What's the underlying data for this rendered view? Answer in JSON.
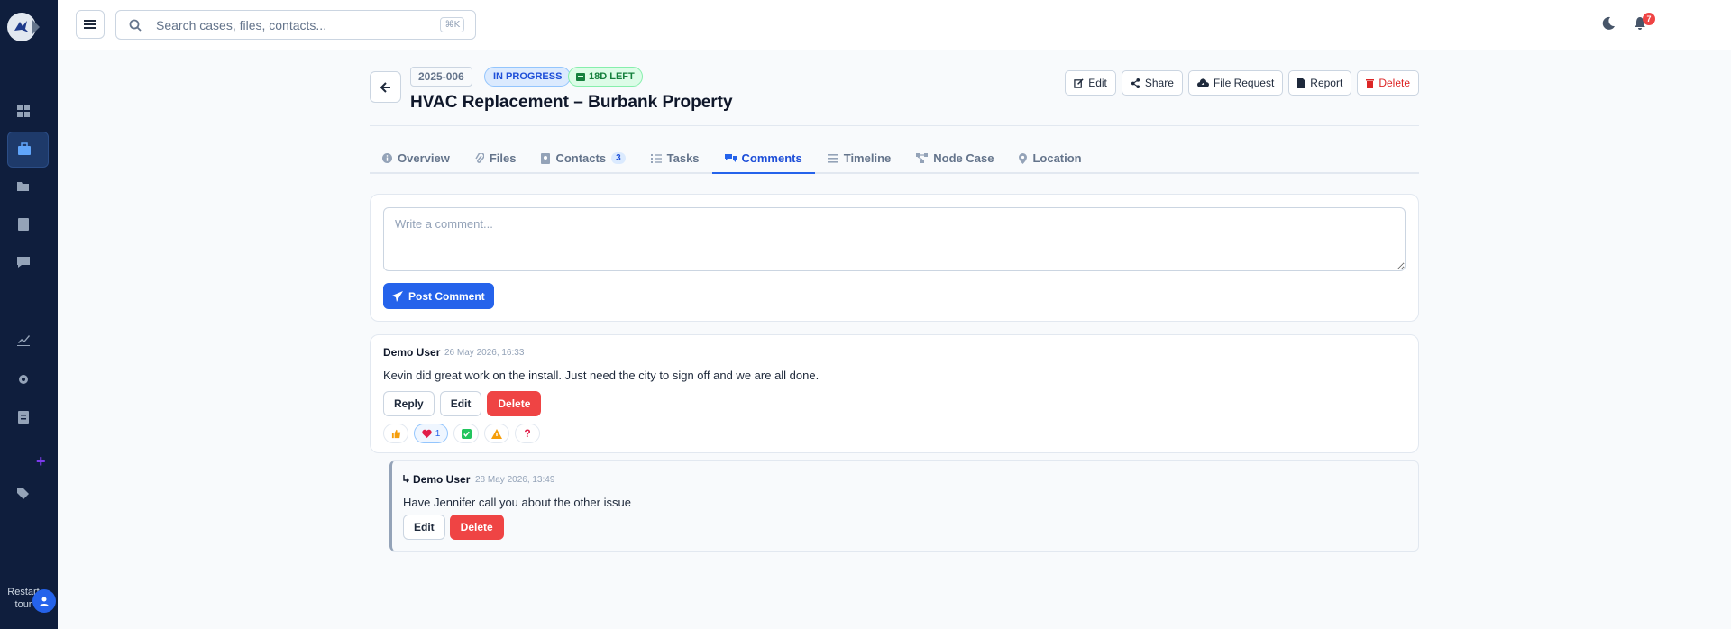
{
  "sidebar": {
    "restart_label": "Restart tour"
  },
  "topbar": {
    "search_placeholder": "Search cases, files, contacts...",
    "search_shortcut": "⌘K",
    "notification_count": "7"
  },
  "case": {
    "id": "2025-006",
    "status": "IN PROGRESS",
    "days_left": "18D LEFT",
    "title": "HVAC Replacement – Burbank Property",
    "actions": {
      "edit": "Edit",
      "share": "Share",
      "file_request": "File Request",
      "report": "Report",
      "delete": "Delete"
    }
  },
  "tabs": [
    {
      "label": "Overview"
    },
    {
      "label": "Files"
    },
    {
      "label": "Contacts",
      "count": "3"
    },
    {
      "label": "Tasks"
    },
    {
      "label": "Comments"
    },
    {
      "label": "Timeline"
    },
    {
      "label": "Node Case"
    },
    {
      "label": "Location"
    }
  ],
  "composer": {
    "placeholder": "Write a comment...",
    "post_label": "Post Comment"
  },
  "comments": [
    {
      "author": "Demo User",
      "date": "26 May 2026, 16:33",
      "text": "Kevin did great work on the install. Just need the city to sign off and we are all done.",
      "reply_label": "Reply",
      "edit_label": "Edit",
      "delete_label": "Delete",
      "reactions": [
        {
          "icon": "thumbs-up",
          "count": ""
        },
        {
          "icon": "heart",
          "count": "1"
        },
        {
          "icon": "check",
          "count": ""
        },
        {
          "icon": "warning",
          "count": ""
        },
        {
          "icon": "question",
          "count": ""
        }
      ]
    }
  ],
  "reply": {
    "author": "Demo User",
    "date": "28 May 2026, 13:49",
    "text": "Have Jennifer call you about the other issue",
    "edit_label": "Edit",
    "delete_label": "Delete"
  },
  "colors": {
    "sidebar_bg": "#0f1e3d",
    "accent": "#2563eb",
    "danger": "#ef4444"
  }
}
